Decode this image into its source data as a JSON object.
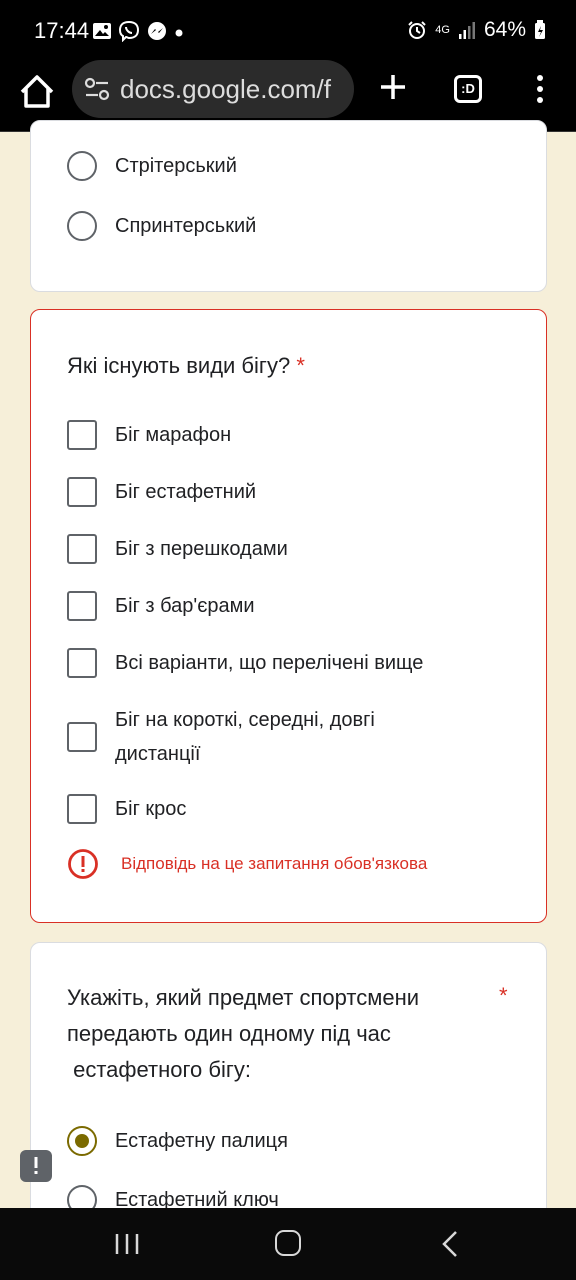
{
  "status_bar": {
    "time": "17:44",
    "battery": "64%",
    "network": "4G"
  },
  "browser": {
    "url": "docs.google.com/f",
    "tab_label": ":D"
  },
  "cards": [
    {
      "options": [
        {
          "label": "Стрітерський"
        },
        {
          "label": "Спринтерський"
        }
      ]
    },
    {
      "question": "Які існують види бігу?",
      "required_mark": "*",
      "options": [
        {
          "label": "Біг марафон"
        },
        {
          "label": "Біг естафетний"
        },
        {
          "label": "Біг з перешкодами"
        },
        {
          "label": "Біг з бар'єрами"
        },
        {
          "label": "Всі варіанти, що перелічені вище"
        },
        {
          "label": "Біг на короткі, середні, довгі дистанції"
        },
        {
          "label": "Біг крос"
        }
      ],
      "error": "Відповідь на це запитання обов'язкова"
    },
    {
      "question_lines": [
        "Укажіть, який предмет спортсмени",
        "передають один одному під час",
        " естафетного бігу:"
      ],
      "required_mark": "*",
      "options": [
        {
          "label": "Естафетну палиця",
          "selected": true
        },
        {
          "label": "Естафетний ключ",
          "selected": false
        }
      ]
    }
  ],
  "colors": {
    "accent": "#7b6a00",
    "error": "#d93025",
    "background": "#f6efd9"
  }
}
